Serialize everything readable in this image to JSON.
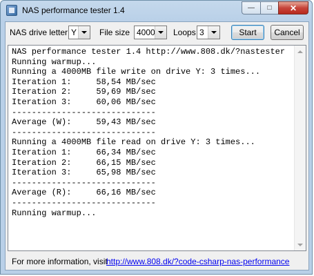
{
  "window": {
    "title": "NAS performance tester 1.4",
    "minimize_glyph": "—",
    "maximize_glyph": "□",
    "close_glyph": "✕"
  },
  "toolbar": {
    "drive_label": "NAS drive letter",
    "drive_value": "Y",
    "filesize_label": "File size",
    "filesize_value": "4000",
    "loops_label": "Loops",
    "loops_value": "3",
    "start_label": "Start",
    "cancel_label": "Cancel"
  },
  "output": {
    "lines": [
      "NAS performance tester 1.4 http://www.808.dk/?nastester",
      "Running warmup...",
      "Running a 4000MB file write on drive Y: 3 times...",
      "Iteration 1:     58,54 MB/sec",
      "Iteration 2:     59,69 MB/sec",
      "Iteration 3:     60,06 MB/sec",
      "-----------------------------",
      "Average (W):     59,43 MB/sec",
      "-----------------------------",
      "Running a 4000MB file read on drive Y: 3 times...",
      "Iteration 1:     66,34 MB/sec",
      "Iteration 2:     66,15 MB/sec",
      "Iteration 3:     65,98 MB/sec",
      "-----------------------------",
      "Average (R):     66,16 MB/sec",
      "-----------------------------",
      "Running warmup..."
    ]
  },
  "footer": {
    "info_label": "For more information, visit",
    "link_text": "http://www.808.dk/?code-csharp-nas-performance"
  }
}
